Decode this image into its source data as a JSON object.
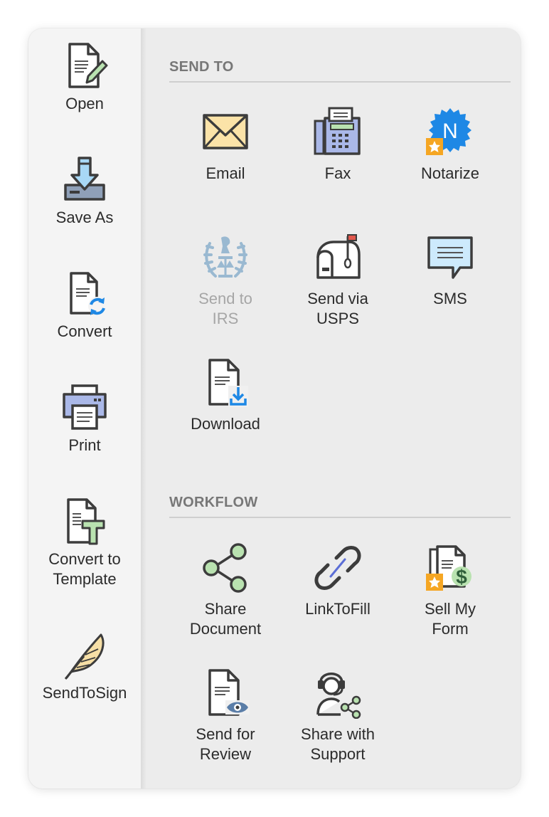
{
  "sidebar": {
    "items": [
      {
        "label": "Open"
      },
      {
        "label": "Save As"
      },
      {
        "label": "Convert"
      },
      {
        "label": "Print"
      },
      {
        "label": "Convert to\nTemplate"
      },
      {
        "label": "SendToSign"
      }
    ]
  },
  "send_to": {
    "title": "SEND TO",
    "items": [
      {
        "label": "Email",
        "icon": "envelope-icon"
      },
      {
        "label": "Fax",
        "icon": "fax-icon"
      },
      {
        "label": "Notarize",
        "icon": "notary-seal-icon"
      },
      {
        "label": "Send to\nIRS",
        "icon": "irs-emblem-icon",
        "disabled": true
      },
      {
        "label": "Send via\nUSPS",
        "icon": "mailbox-icon"
      },
      {
        "label": "SMS",
        "icon": "chat-bubble-icon"
      },
      {
        "label": "Download",
        "icon": "document-download-icon"
      }
    ]
  },
  "workflow": {
    "title": "WORKFLOW",
    "items": [
      {
        "label": "Share\nDocument",
        "icon": "share-icon"
      },
      {
        "label": "LinkToFill",
        "icon": "link-icon"
      },
      {
        "label": "Sell My\nForm",
        "icon": "document-dollar-icon"
      },
      {
        "label": "Send for\nReview",
        "icon": "document-eye-icon"
      },
      {
        "label": "Share with\nSupport",
        "icon": "support-agent-icon"
      }
    ]
  },
  "colors": {
    "accent_blue": "#1e88e5",
    "star_orange": "#f5a623",
    "icon_outline": "#3c3c3c",
    "green_fill": "#b9e2b0",
    "disabled_text": "#a6a6a6"
  }
}
